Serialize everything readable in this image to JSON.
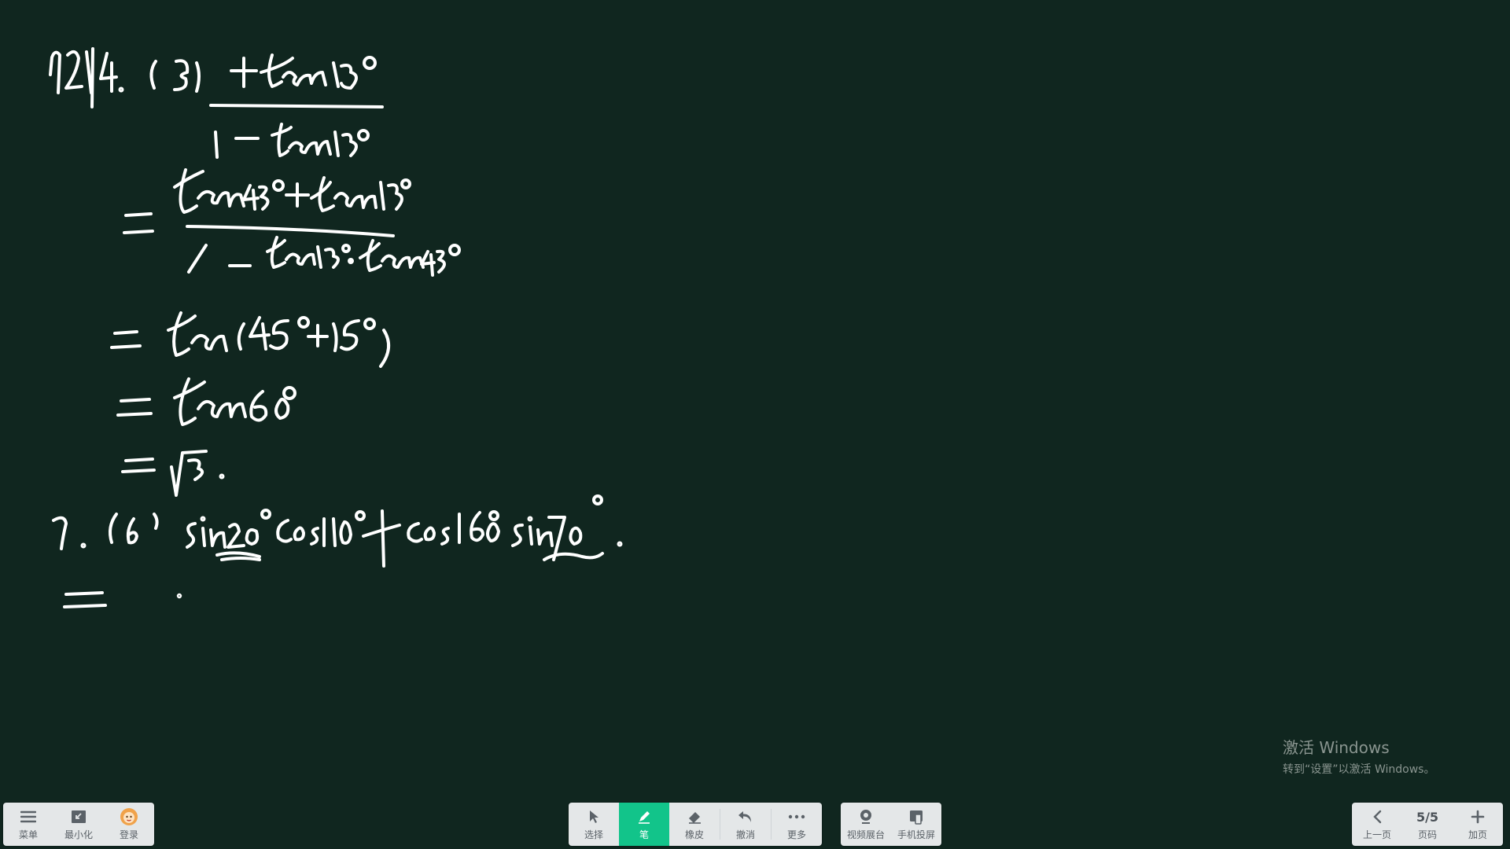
{
  "left_toolbar": {
    "menu_label": "菜单",
    "minimize_label": "最小化",
    "login_label": "登录"
  },
  "center_toolbar": {
    "select_label": "选择",
    "pen_label": "笔",
    "eraser_label": "橡皮",
    "undo_label": "撤消",
    "more_label": "更多",
    "accent_color": "#12c48a"
  },
  "media_toolbar": {
    "video_booth_label": "视频展台",
    "phone_cast_label": "手机投屏"
  },
  "page_nav": {
    "prev_label": "上一页",
    "page_indicator": "5/5",
    "page_label": "页码",
    "add_label": "加页"
  },
  "watermark": {
    "title": "激活 Windows",
    "subtitle": "转到“设置”以激活 Windows。"
  },
  "board": {
    "background_color": "#10261f",
    "ink_color": "#ffffff"
  }
}
